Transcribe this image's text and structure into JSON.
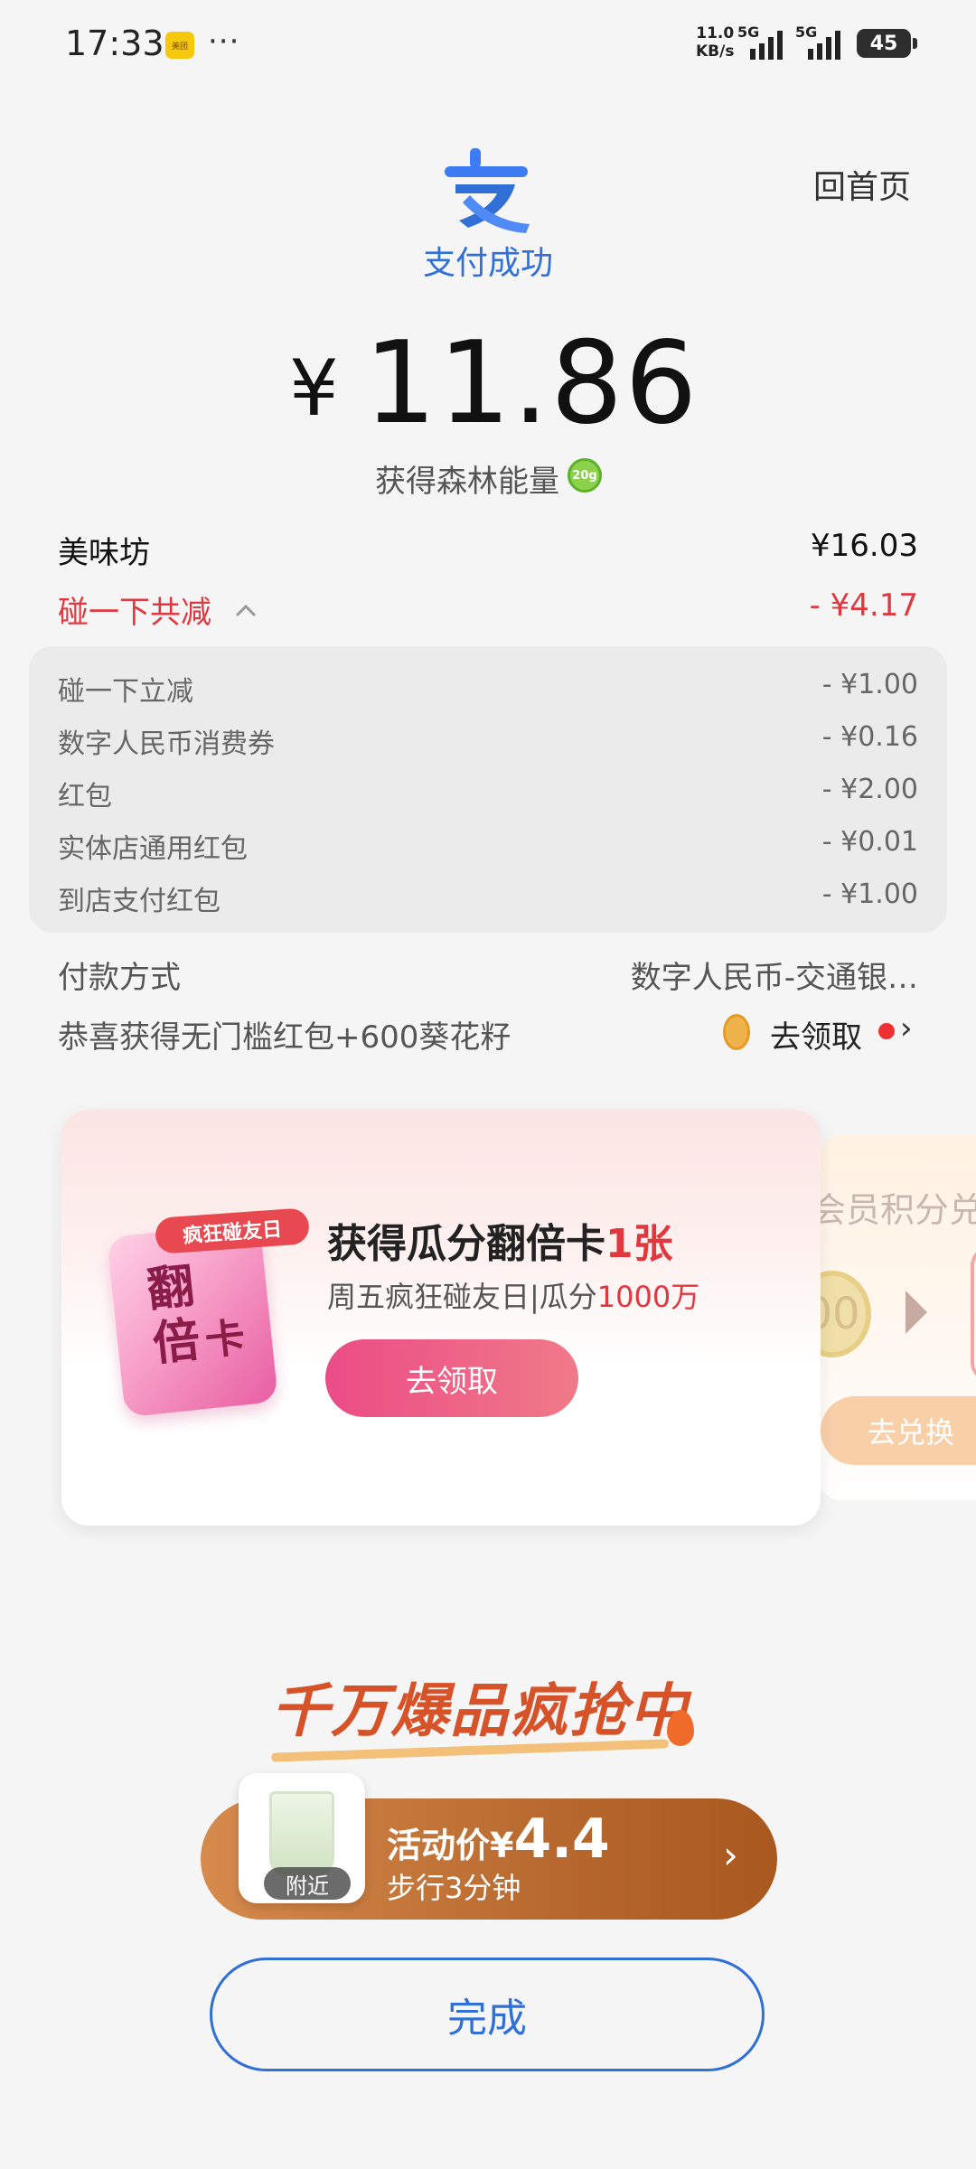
{
  "status_bar": {
    "time": "17:33",
    "app_badge": "美团",
    "more": "···",
    "net_speed_value": "11.0",
    "net_speed_unit": "KB/s",
    "sim1": "5G",
    "sim2": "5G",
    "battery": "45"
  },
  "header": {
    "home_label": "回首页",
    "status": "支付成功",
    "currency": "¥",
    "amount": "11.86",
    "energy_label": "获得森林能量",
    "energy_badge": "20g"
  },
  "merchant": {
    "name": "美味坊",
    "original_amount": "¥16.03",
    "discount_label": "碰一下共减",
    "discount_total": "- ¥4.17"
  },
  "discounts": [
    {
      "label": "碰一下立减",
      "value": "- ¥1.00"
    },
    {
      "label": "数字人民币消费券",
      "value": "- ¥0.16"
    },
    {
      "label": "红包",
      "value": "- ¥2.00"
    },
    {
      "label": "实体店通用红包",
      "value": "- ¥0.01"
    },
    {
      "label": "到店支付红包",
      "value": "- ¥1.00"
    }
  ],
  "payment": {
    "label": "付款方式",
    "method": "数字人民币-交通银…"
  },
  "reward": {
    "text": "恭喜获得无门槛红包+600葵花籽",
    "action": "去领取"
  },
  "promo_card": {
    "badge": "疯狂碰友日",
    "image_text_1": "翻",
    "image_text_2": "倍",
    "image_text_3": "卡",
    "title_prefix": "获得瓜分翻倍卡",
    "title_highlight": "1张",
    "subtitle_prefix": "周五疯狂碰友日|瓜分",
    "subtitle_highlight": "1000万",
    "button": "去领取"
  },
  "promo_card_2": {
    "title": "会员积分兑",
    "coin_text": "00",
    "button": "去兑换"
  },
  "deal": {
    "slogan": "千万爆品疯抢中",
    "near_label": "附近",
    "price_label": "活动价",
    "price_currency": "¥",
    "price_value": "4.4",
    "walk_text": "步行3分钟"
  },
  "footer": {
    "done_button": "完成"
  },
  "colors": {
    "brand_blue": "#2f6fd6",
    "discount_red": "#e0383e",
    "promo_pink": "#eb4c86",
    "deal_brown": "#b8692f"
  }
}
